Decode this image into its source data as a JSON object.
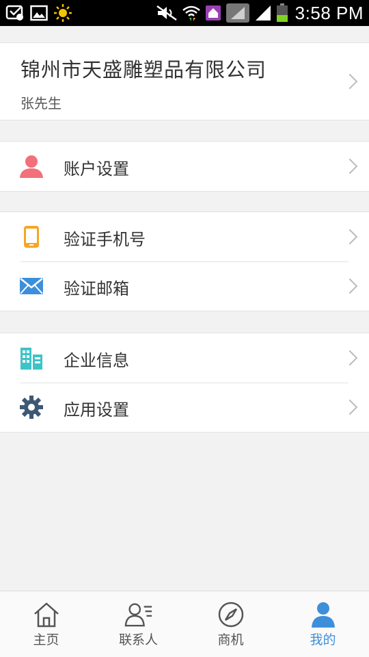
{
  "status_bar": {
    "time": "3:58 PM"
  },
  "company": {
    "name": "锦州市天盛雕塑品有限公司",
    "contact": "张先生"
  },
  "groups": [
    {
      "items": [
        {
          "label": "账户设置",
          "icon": "user-icon",
          "color": "#f2707c"
        }
      ]
    },
    {
      "items": [
        {
          "label": "验证手机号",
          "icon": "phone-icon",
          "color": "#f5a623"
        },
        {
          "label": "验证邮箱",
          "icon": "mail-icon",
          "color": "#3d8fd9"
        }
      ]
    },
    {
      "items": [
        {
          "label": "企业信息",
          "icon": "building-icon",
          "color": "#3cc4c8"
        },
        {
          "label": "应用设置",
          "icon": "gear-icon",
          "color": "#3e5874"
        }
      ]
    }
  ],
  "bottom_nav": {
    "active_color": "#3d8fd9",
    "items": [
      {
        "label": "主页",
        "icon": "home-icon"
      },
      {
        "label": "联系人",
        "icon": "contacts-icon"
      },
      {
        "label": "商机",
        "icon": "compass-icon"
      },
      {
        "label": "我的",
        "icon": "person-icon",
        "active": true
      }
    ]
  }
}
